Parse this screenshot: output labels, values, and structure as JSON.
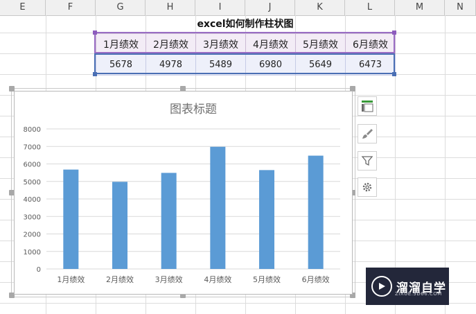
{
  "sheet": {
    "columns": [
      "E",
      "F",
      "G",
      "H",
      "I",
      "J",
      "K",
      "L",
      "M",
      "N"
    ]
  },
  "table": {
    "title": "excel如何制作柱状图",
    "headers": [
      "1月绩效",
      "2月绩效",
      "3月绩效",
      "4月绩效",
      "5月绩效",
      "6月绩效"
    ],
    "values": [
      "5678",
      "4978",
      "5489",
      "6980",
      "5649",
      "6473"
    ]
  },
  "chart_data": {
    "type": "bar",
    "title": "图表标题",
    "categories": [
      "1月绩效",
      "2月绩效",
      "3月绩效",
      "4月绩效",
      "5月绩效",
      "6月绩效"
    ],
    "values": [
      5678,
      4978,
      5489,
      6980,
      5649,
      6473
    ],
    "ylim": [
      0,
      8000
    ],
    "yticks": [
      "0",
      "1000",
      "2000",
      "3000",
      "4000",
      "5000",
      "6000",
      "7000",
      "8000"
    ],
    "grid": true,
    "bar_color": "#5b9bd5"
  },
  "chart_tools": [
    "chart-elements-icon",
    "chart-style-icon",
    "chart-filter-icon",
    "chart-settings-icon"
  ],
  "watermark": {
    "name": "溜溜自学",
    "url": "ZIXUE.3D66.COM"
  }
}
